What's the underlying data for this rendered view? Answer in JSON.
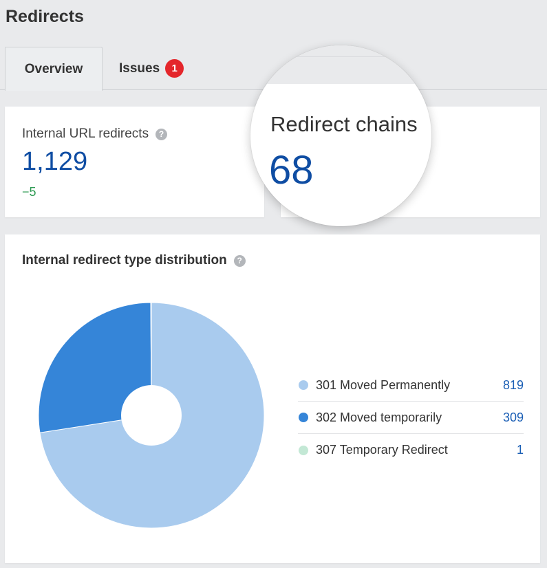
{
  "page": {
    "title": "Redirects"
  },
  "tabs": [
    {
      "label": "Overview",
      "active": true
    },
    {
      "label": "Issues",
      "badge": "1"
    }
  ],
  "cards": {
    "internal_url_redirects": {
      "label": "Internal URL redirects",
      "value": "1,129",
      "delta": "−5"
    },
    "redirect_chains": {
      "label": "Redirect chains",
      "value": "68"
    }
  },
  "distribution": {
    "title": "Internal redirect type distribution",
    "legend": [
      {
        "label": "301 Moved Permanently",
        "value": "819",
        "color": "#a9cbee"
      },
      {
        "label": "302 Moved temporarily",
        "value": "309",
        "color": "#3585d8"
      },
      {
        "label": "307 Temporary Redirect",
        "value": "1",
        "color": "#c3e8d5"
      }
    ]
  },
  "chart_data": {
    "type": "pie",
    "categories": [
      "301 Moved Permanently",
      "302 Moved temporarily",
      "307 Temporary Redirect"
    ],
    "values": [
      819,
      309,
      1
    ],
    "colors": [
      "#a9cbee",
      "#3585d8",
      "#c3e8d5"
    ],
    "donut": true,
    "legend": "right"
  }
}
